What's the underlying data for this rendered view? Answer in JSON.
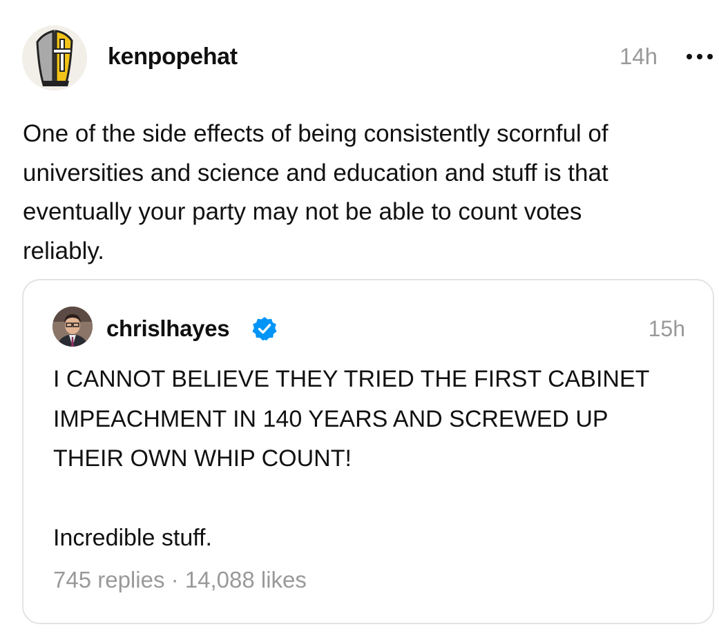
{
  "post": {
    "username": "kenpopehat",
    "timestamp": "14h",
    "avatar_icon": "bishop-mitre-icon",
    "more_icon": "more-options-icon",
    "text": "One of the side effects of being consistently scornful of\nuniversities and science and education and stuff is that\neventually your party may not be able to count votes\nreliably."
  },
  "quote": {
    "username": "chrislhayes",
    "verified_icon": "verified-badge-icon",
    "verified_color": "#0095f6",
    "timestamp": "15h",
    "text": "I CANNOT BELIEVE THEY TRIED THE FIRST CABINET\nIMPEACHMENT IN 140 YEARS AND SCREWED UP\nTHEIR OWN WHIP COUNT!\n\nIncredible stuff.",
    "replies": "745 replies",
    "separator": "·",
    "likes": "14,088 likes"
  }
}
